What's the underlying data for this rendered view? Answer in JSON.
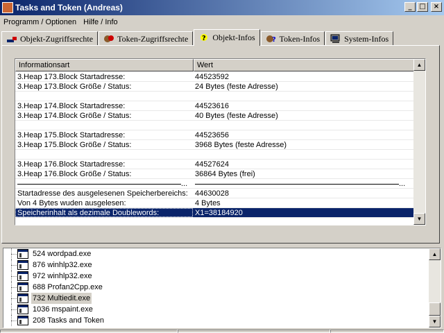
{
  "window": {
    "title": "Tasks and Token  (Andreas)",
    "buttons": {
      "minimize": "_",
      "maximize": "□",
      "close": "×"
    }
  },
  "menu": {
    "items": [
      {
        "label": "Programm / Optionen"
      },
      {
        "label": "Hilfe / Info"
      }
    ]
  },
  "tabs": [
    {
      "label": "Objekt-Zugriffsrechte",
      "icon": "object-access-icon",
      "active": false
    },
    {
      "label": "Token-Zugriffsrechte",
      "icon": "token-access-icon",
      "active": false
    },
    {
      "label": "Objekt-Infos",
      "icon": "question-bulb-icon",
      "active": true
    },
    {
      "label": "Token-Infos",
      "icon": "token-info-icon",
      "active": false
    },
    {
      "label": "System-Infos",
      "icon": "computer-icon",
      "active": false
    }
  ],
  "listview": {
    "columns": [
      "Informationsart",
      "Wert"
    ],
    "rows": [
      {
        "c1": "3.Heap 173.Block Startadresse:",
        "c2": "44523592"
      },
      {
        "c1": "3.Heap 173.Block Größe / Status:",
        "c2": "24 Bytes (feste Adresse)"
      },
      {
        "c1": "",
        "c2": ""
      },
      {
        "c1": "3.Heap 174.Block Startadresse:",
        "c2": "44523616"
      },
      {
        "c1": "3.Heap 174.Block Größe / Status:",
        "c2": "40 Bytes (feste Adresse)"
      },
      {
        "c1": "",
        "c2": ""
      },
      {
        "c1": "3.Heap 175.Block Startadresse:",
        "c2": "44523656"
      },
      {
        "c1": "3.Heap 175.Block Größe / Status:",
        "c2": "3968 Bytes (feste Adresse)"
      },
      {
        "c1": "",
        "c2": ""
      },
      {
        "c1": "3.Heap 176.Block Startadresse:",
        "c2": "44527624"
      },
      {
        "c1": "3.Heap 176.Block Größe / Status:",
        "c2": "36864 Bytes (frei)"
      },
      {
        "c1": "...",
        "c2": "...",
        "separator": true
      },
      {
        "c1": "Startadresse des ausgelesenen Speicherbereichs:",
        "c2": "44630028"
      },
      {
        "c1": "Von 4 Bytes wuden ausgelesen:",
        "c2": "4 Bytes"
      },
      {
        "c1": "Speicherinhalt als dezimale Doublewords:",
        "c2": "X1=38184920",
        "selected": true
      }
    ],
    "scroll": {
      "up": "▲",
      "down": "▼"
    }
  },
  "process_tree": {
    "items": [
      {
        "label": "524 wordpad.exe"
      },
      {
        "label": "876 winhlp32.exe"
      },
      {
        "label": "972 winhlp32.exe"
      },
      {
        "label": "688 Profan2Cpp.exe"
      },
      {
        "label": "732 Multiedit.exe",
        "highlighted": true
      },
      {
        "label": "1036 mspaint.exe"
      },
      {
        "label": "208 Tasks and Token"
      }
    ],
    "scroll": {
      "up": "▲",
      "down": "▼"
    }
  }
}
